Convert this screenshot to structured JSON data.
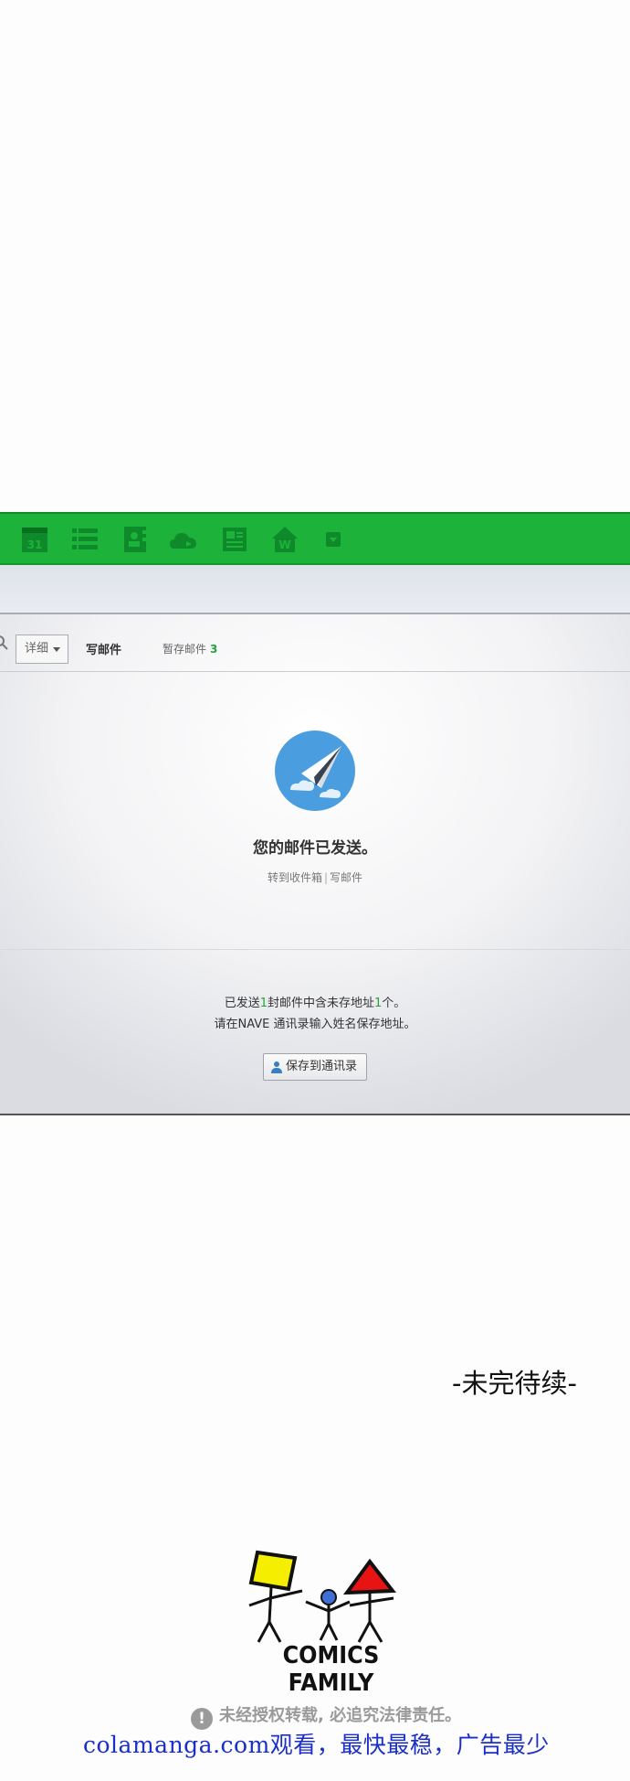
{
  "toolbar_icons": [
    "calendar-icon",
    "list-icon",
    "contacts-icon",
    "cloud-icon",
    "notes-icon",
    "home-icon",
    "more-icon"
  ],
  "calendar_day": "31",
  "search": {
    "detail_label": "详细"
  },
  "tabs": {
    "compose": "写邮件",
    "drafts": "暂存邮件",
    "drafts_count": "3"
  },
  "result": {
    "title": "您的邮件已发送。",
    "inbox_link": "转到收件箱",
    "separator": "|",
    "compose_link": "写邮件"
  },
  "info": {
    "line1_a": "已发送",
    "line1_n1": "1",
    "line1_b": "封邮件中含未存地址",
    "line1_n2": "1",
    "line1_c": "个。",
    "line2": "请在NAVE 通讯录输入姓名保存地址。",
    "save_button": "保存到通讯录"
  },
  "colors": {
    "accent_green": "#1db33b",
    "link_green": "#22a33c",
    "watermark_blue": "#1a2fc9"
  },
  "ending": "-未完待续-",
  "logo": "COMICS FAMILY",
  "warning": "未经授权转载, 必追究法律责任。",
  "warning_icon": "!",
  "watermark": "colamanga.com观看，最快最稳，广告最少"
}
